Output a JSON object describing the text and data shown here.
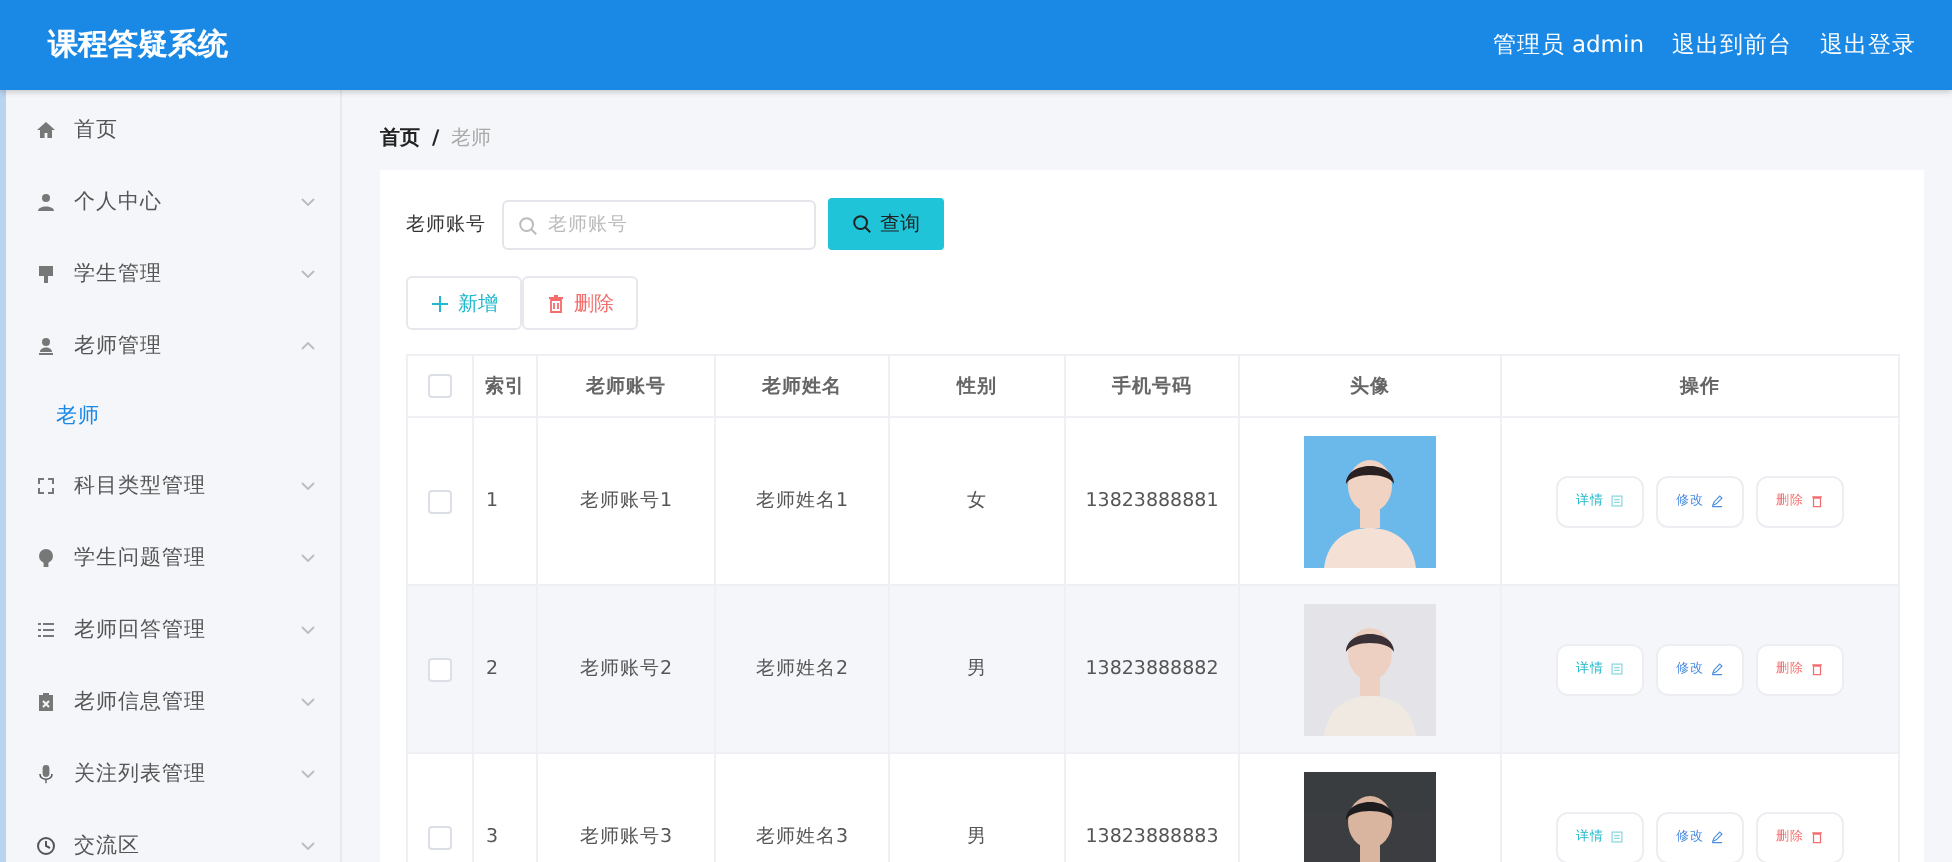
{
  "header": {
    "title": "课程答疑系统",
    "links": [
      "管理员 admin",
      "退出到前台",
      "退出登录"
    ]
  },
  "sidebar": {
    "items": [
      {
        "kind": "link",
        "label": "首页",
        "selected": false
      },
      {
        "kind": "group",
        "label": "个人中心",
        "expanded": false
      },
      {
        "kind": "group",
        "label": "学生管理",
        "expanded": false
      },
      {
        "kind": "group",
        "label": "老师管理",
        "expanded": true,
        "children": [
          {
            "label": "老师",
            "selected": true
          }
        ]
      },
      {
        "kind": "group",
        "label": "科目类型管理",
        "expanded": false
      },
      {
        "kind": "group",
        "label": "学生问题管理",
        "expanded": false
      },
      {
        "kind": "group",
        "label": "老师回答管理",
        "expanded": false
      },
      {
        "kind": "group",
        "label": "老师信息管理",
        "expanded": false
      },
      {
        "kind": "group",
        "label": "关注列表管理",
        "expanded": false
      },
      {
        "kind": "group",
        "label": "交流区",
        "expanded": false
      }
    ]
  },
  "breadcrumb": [
    "首页",
    "/",
    "老师"
  ],
  "search": {
    "label": "老师账号",
    "placeholder": "老师账号",
    "button": "查询"
  },
  "actions": [
    "新增",
    "删除"
  ],
  "table": {
    "select_all_checked": false,
    "columns": [
      "索引",
      "老师账号",
      "老师姓名",
      "性别",
      "手机号码",
      "头像",
      "操作"
    ],
    "rows": [
      {
        "checked": false,
        "cells": [
          "1",
          "老师账号1",
          "老师姓名1",
          "女",
          "13823888881"
        ],
        "buttons": [
          "详情",
          "修改",
          "删除"
        ]
      },
      {
        "checked": false,
        "cells": [
          "2",
          "老师账号2",
          "老师姓名2",
          "男",
          "13823888882"
        ],
        "buttons": [
          "详情",
          "修改",
          "删除"
        ]
      },
      {
        "checked": false,
        "cells": [
          "3",
          "老师账号3",
          "老师姓名3",
          "男",
          "13823888883"
        ],
        "buttons": [
          "详情",
          "修改",
          "删除"
        ]
      }
    ]
  }
}
